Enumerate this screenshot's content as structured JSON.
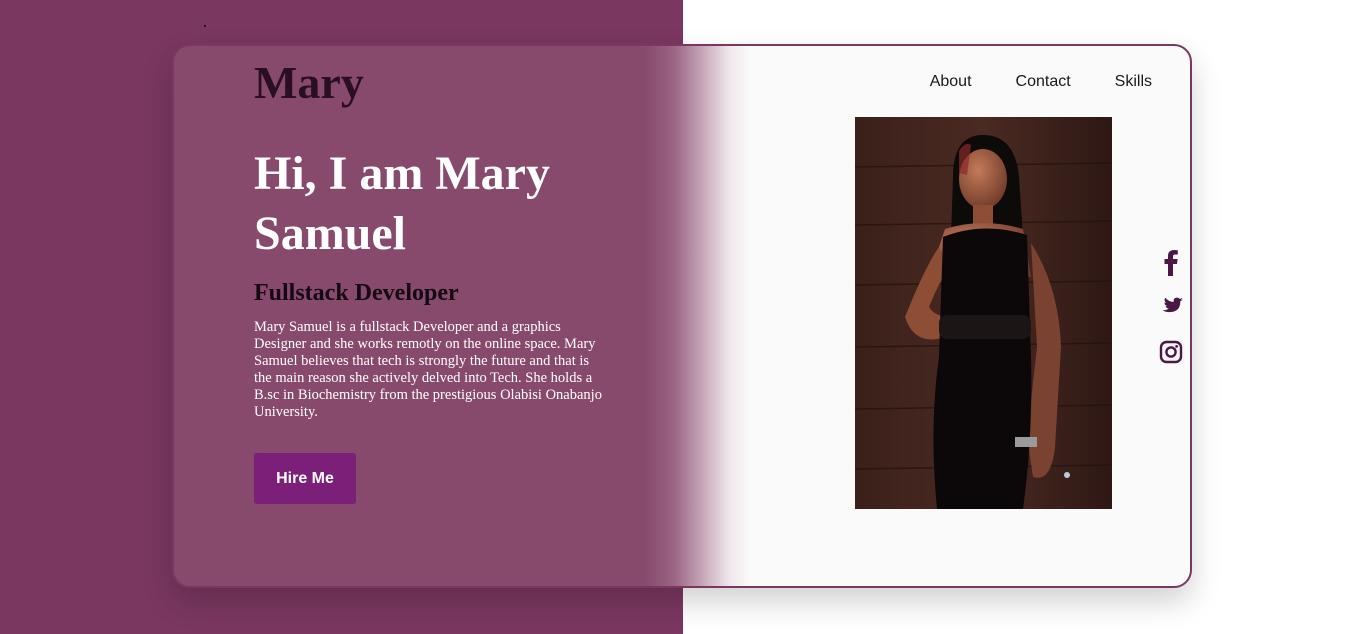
{
  "brand": {
    "logo": "Mary"
  },
  "nav": {
    "items": [
      "About",
      "Contact",
      "Skills"
    ]
  },
  "hero": {
    "title": "Hi, I am Mary Samuel",
    "subtitle": "Fullstack Developer",
    "bio": "Mary Samuel is a fullstack Developer and a graphics Designer and she works remotly on the online space. Mary Samuel believes that tech is strongly the future and that is the main reason she actively delved into Tech. She holds a B.sc in Biochemistry from the prestigious Olabisi Onabanjo University.",
    "cta_label": "Hire Me"
  },
  "social": {
    "icons": [
      "facebook-icon",
      "twitter-icon",
      "instagram-icon"
    ]
  },
  "colors": {
    "page_left_bg": "#7a3760",
    "card_left_bg": "#874a6c",
    "card_right_bg": "#fafafa",
    "button_bg": "#7b1f78",
    "icon_color": "#4a1746",
    "logo_color": "#2a0f22"
  }
}
